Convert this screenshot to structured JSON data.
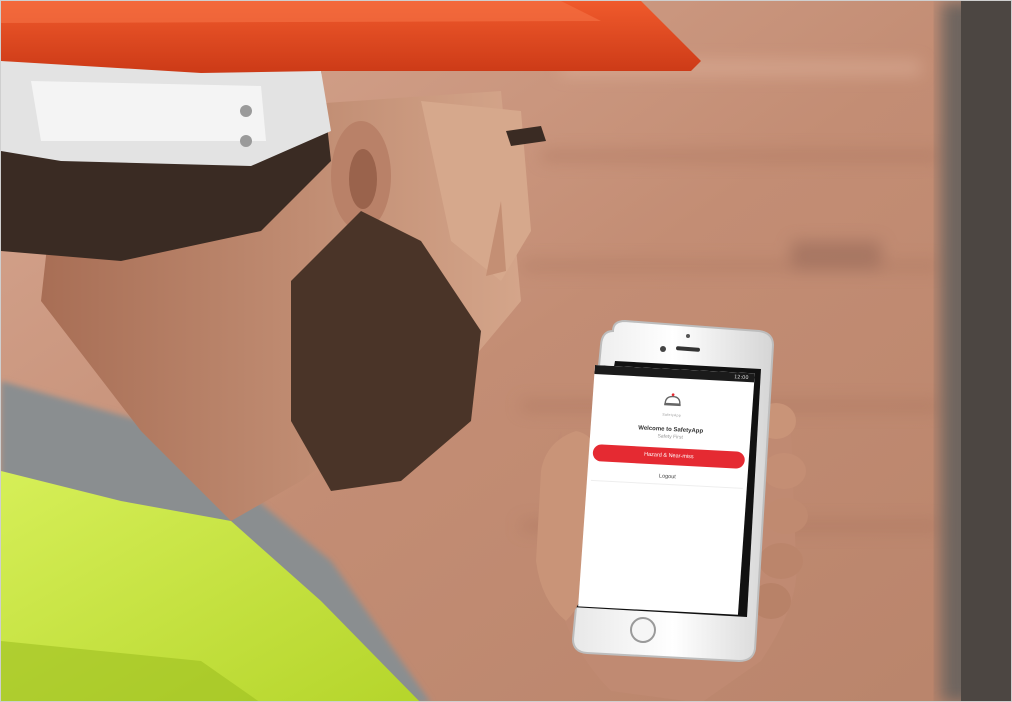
{
  "app": {
    "status_time": "12:00",
    "brand_name": "SafetyApp",
    "welcome_text": "Welcome to SafetyApp",
    "subtitle": "Safety First",
    "primary_button": "Hazard & Near-miss",
    "secondary_button": "Logout"
  },
  "colors": {
    "accent": "#e52a32",
    "helmet": "#e0401f",
    "vest": "#c8e63a",
    "wall": "#c99a80"
  },
  "icons": {
    "logo": "hardhat-icon",
    "home": "home-button-icon"
  }
}
